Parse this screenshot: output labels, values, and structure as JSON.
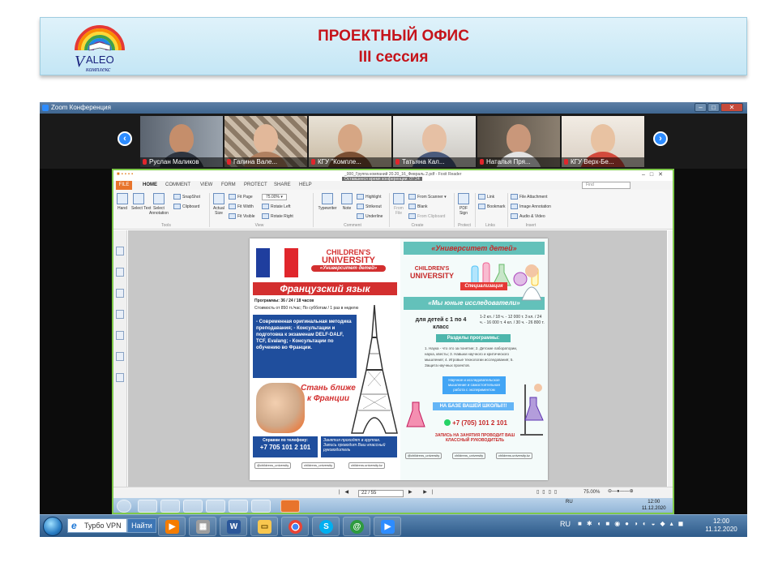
{
  "slide": {
    "title_line1": "ПРОЕКТНЫЙ ОФИС",
    "title_line2": "III сессия",
    "logo_text": "VALEO комплекс"
  },
  "zoom": {
    "window_title": "Zoom Конференция",
    "participants": [
      {
        "name": "Руслан Маликов"
      },
      {
        "name": "Галина Вале..."
      },
      {
        "name": "КГУ \"Комплe..."
      },
      {
        "name": "Татьяна Кал..."
      },
      {
        "name": "Наталья Пря..."
      },
      {
        "name": "КГУ Верх-Бе..."
      }
    ]
  },
  "foxit": {
    "doc_title": "_000_Группа компаний 20.20_16_Февраль 2.pdf - Foxit Reader",
    "remaining": "Оставшееся время конференции: 07:24",
    "tabs": [
      "FILE",
      "HOME",
      "COMMENT",
      "VIEW",
      "FORM",
      "PROTECT",
      "SHARE",
      "HELP"
    ],
    "find_placeholder": "Find",
    "ribbon": {
      "hand": "Hand",
      "select_text": "Select Text",
      "select_annotation": "Select Annotation",
      "snapshot": "SnapShot",
      "clipboard": "Clipboard",
      "actual_size": "Actual Size",
      "fit_page": "Fit Page",
      "fit_width": "Fit Width",
      "fit_visible": "Fit Visible",
      "zoom_value": "75.00%",
      "rotate_left": "Rotate Left",
      "rotate_right": "Rotate Right",
      "typewriter": "Typewriter",
      "note": "Note",
      "highlight": "Highlight",
      "strikeout": "Strikeout",
      "underline": "Underline",
      "from_file": "From File",
      "from_scanner": "From Scanner",
      "blank": "Blank",
      "from_clipboard": "From Clipboard",
      "pdf_sign": "PDF Sign",
      "link": "Link",
      "bookmark": "Bookmark",
      "file_attachment": "File Attachment",
      "image_annotation": "Image Annotation",
      "audio_video": "Audio & Video",
      "groups": [
        "Tools",
        "View",
        "Comment",
        "Create",
        "Protect",
        "Links",
        "Insert"
      ]
    },
    "status": {
      "page": "22 / 55",
      "zoom": "75.00%"
    }
  },
  "flyer_left": {
    "logo_line1": "CHILDREN'S",
    "logo_line2": "UNIVERSITY",
    "logo_line3": "«Университет детей»",
    "title": "Французский язык",
    "programs": "Программы: 36 / 24 / 18 часов",
    "price": "Стоимость от 850 тг./час; По субботам / 1 раз в неделю",
    "bullets": "- Современная оригинальная методика преподавания; - Консультации и подготовка к экзаменам DELF-DALF, TCF, Evalang; - Консультации по обучению во Франции.",
    "slogan": "Стань ближе к Франции",
    "contact_label": "Справки по телефону:",
    "phone": "+7 705 101 2 101",
    "enroll": "Занятия проходят в группах. Запись проводит Ваш классный руководитель",
    "social": [
      "@childrens_university",
      "childrens_university",
      "childrens.university.kz"
    ]
  },
  "flyer_right": {
    "title": "«Университет детей»",
    "logo_line1": "CHILDREN'S",
    "logo_line2": "UNIVERSITY",
    "specialization": "Специализация",
    "subtitle": "«Мы юные исследователи»",
    "audience": "для детей с 1 по 4 класс",
    "prices": "1-2 кл. / 18 ч. - 12 000 т. 3 кл. / 24 ч. - 16 000 т. 4 кл. / 30 ч. - 26 800 т.",
    "sections_label": "Разделы программы:",
    "sections": "1. Наука - что это за понятие; 2. Детские лаборатории, наука, квесты; 3. Навыки научного и критического мышления; 4. Игровые технологии исследования; 5. Защита научных проектов.",
    "note": "Научное и исследовательское мышление и самостоятельная работа с экспериментом",
    "at_school": "НА БАЗЕ ВАШЕЙ ШКОЛЫ!!!",
    "phone": "+7 (705) 101 2 101",
    "signup": "ЗАПИСЬ НА ЗАНЯТИЯ ПРОВОДИТ ВАШ КЛАССНЫЙ РУКОВОДИТЕЛЬ",
    "social": [
      "@childrens_university",
      "childrens_university",
      "childrens.university.kz"
    ]
  },
  "taskbar": {
    "search_placeholder": "Турбо VPN",
    "search_button": "Найти",
    "lang": "RU",
    "time": "12:00",
    "date": "11.12.2020"
  },
  "inner_tray": {
    "lang": "RU",
    "time": "12:00",
    "date": "11.12.2020"
  },
  "colors": {
    "title_red": "#c5141b",
    "zoom_blue": "#2d8cff",
    "foxit_orange": "#e8742c",
    "flyer_red": "#d32f2f",
    "flyer_blue": "#1f4e9d",
    "flyer_teal": "#63c1ba"
  }
}
